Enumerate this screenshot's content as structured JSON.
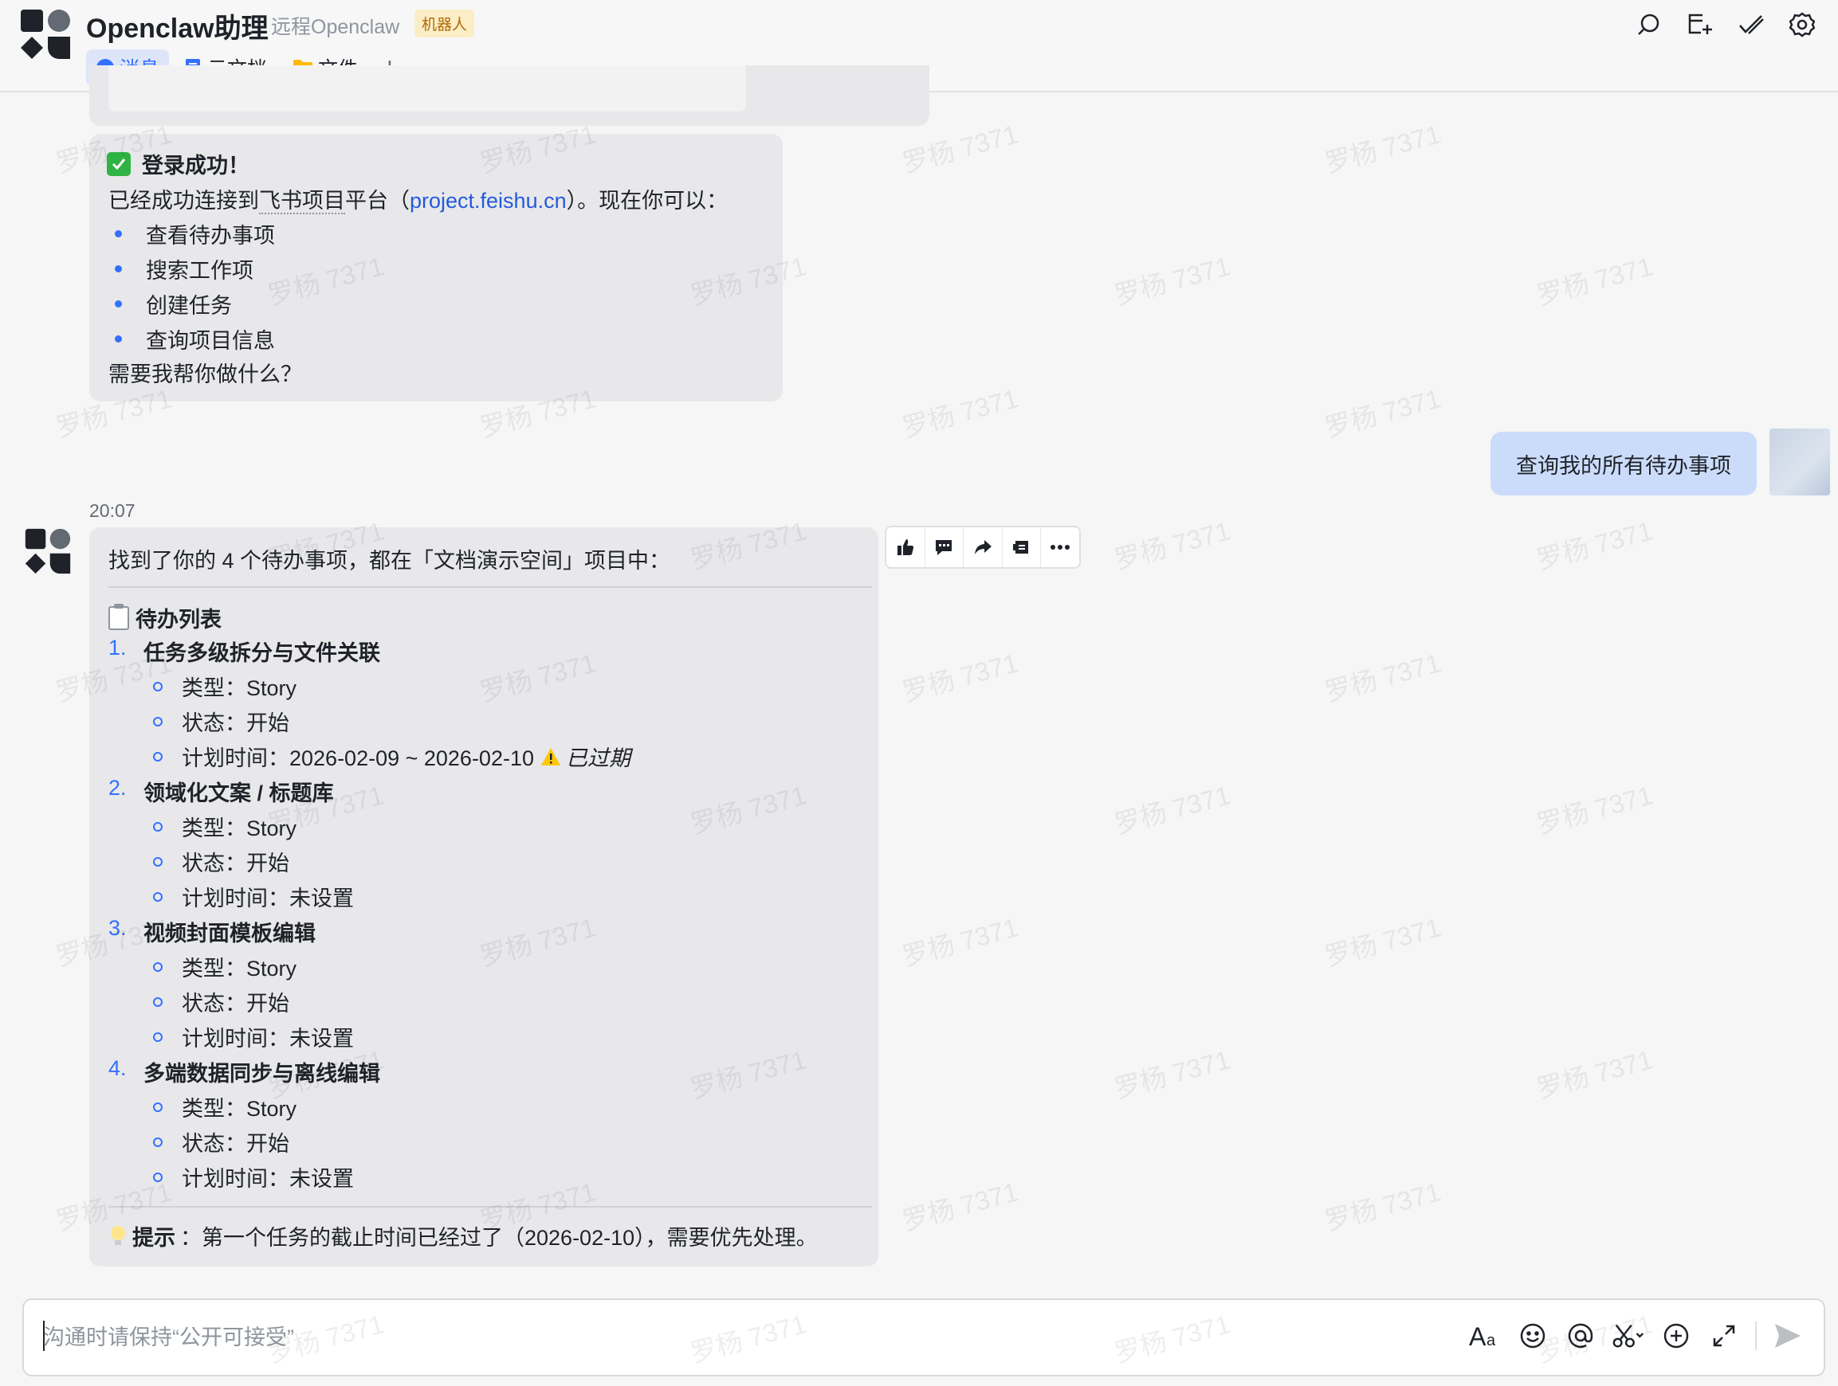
{
  "header": {
    "title": "Openclaw助理",
    "subtitle": "远程Openclaw",
    "bot_tag": "机器人",
    "tabs": [
      {
        "label": "消息",
        "icon": "message-icon",
        "active": true
      },
      {
        "label": "云文档",
        "icon": "doc-icon",
        "active": false
      },
      {
        "label": "文件",
        "icon": "folder-icon",
        "active": false
      }
    ],
    "add_tab": "+",
    "right_icons": [
      "search-icon",
      "add-window-icon",
      "checkmark-icon",
      "gear-icon"
    ]
  },
  "messages": {
    "login": {
      "title": "登录成功！",
      "line_prefix": "已经成功连接到",
      "underlined": "飞书项目",
      "line_mid": "平台（",
      "link": "project.feishu.cn",
      "line_suffix": "）。现在你可以：",
      "bullets": [
        "查看待办事项",
        "搜索工作项",
        "创建任务",
        "查询项目信息"
      ],
      "closing": "需要我帮你做什么？"
    },
    "user": {
      "text": "查询我的所有待办事项"
    },
    "timestamp": "20:07",
    "reply": {
      "intro": "找到了你的 4 个待办事项，都在「文档演示空间」项目中：",
      "list_title": "待办列表",
      "tasks": [
        {
          "num": "1.",
          "title": "任务多级拆分与文件关联",
          "type": "类型：Story",
          "status": "状态：开始",
          "plan": "计划时间：2026-02-09 ~ 2026-02-10",
          "flag": "已过期"
        },
        {
          "num": "2.",
          "title": "领域化文案 / 标题库",
          "type": "类型：Story",
          "status": "状态：开始",
          "plan": "计划时间：未设置"
        },
        {
          "num": "3.",
          "title": "视频封面模板编辑",
          "type": "类型：Story",
          "status": "状态：开始",
          "plan": "计划时间：未设置"
        },
        {
          "num": "4.",
          "title": "多端数据同步与离线编辑",
          "type": "类型：Story",
          "status": "状态：开始",
          "plan": "计划时间：未设置"
        }
      ],
      "tip_label": "提示",
      "tip_text": "：第一个任务的截止时间已经过了（2026-02-10），需要优先处理。"
    }
  },
  "message_actions": [
    "thumbs-up-icon",
    "comment-icon",
    "forward-icon",
    "pin-icon",
    "more-icon"
  ],
  "input": {
    "placeholder": "沟通时请保持“公开可接受”",
    "tools": [
      "font-icon",
      "emoji-icon",
      "mention-icon",
      "scissors-icon",
      "add-icon",
      "expand-icon",
      "send-icon"
    ]
  },
  "watermark": "罗杨 7371",
  "colors": {
    "accent": "#3370ff",
    "user_bubble": "#cbdcfb",
    "bot_bubble": "#e8e8ea",
    "success": "#2fb344"
  }
}
